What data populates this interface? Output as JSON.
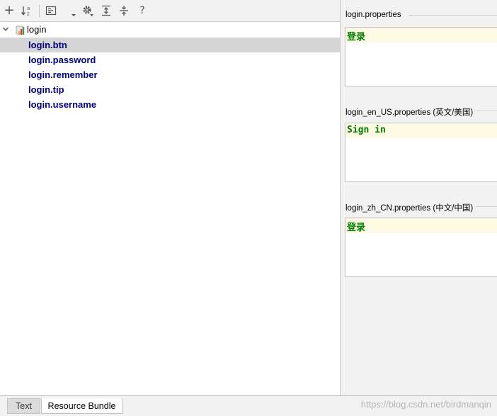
{
  "toolbar": {
    "buttons": [
      {
        "name": "add-property-button",
        "icon": "plus-icon",
        "glyph": "+"
      },
      {
        "name": "sort-alphabetically-button",
        "icon": "sort-az-icon"
      },
      {
        "name": "group-by-prefix-button",
        "icon": "group-icon"
      },
      {
        "name": "dropdown-button",
        "icon": "dropdown-arrow-icon"
      },
      {
        "name": "settings-button",
        "icon": "gear-icon"
      },
      {
        "name": "expand-all-button",
        "icon": "expand-all-icon"
      },
      {
        "name": "collapse-all-button",
        "icon": "collapse-all-icon"
      },
      {
        "name": "help-button",
        "icon": "help-icon",
        "glyph": "?"
      }
    ]
  },
  "tree": {
    "root": {
      "label": "login",
      "icon": "resource-bundle-icon",
      "expanded": true
    },
    "keys": [
      {
        "label": "login.btn",
        "selected": true
      },
      {
        "label": "login.password",
        "selected": false
      },
      {
        "label": "login.remember",
        "selected": false
      },
      {
        "label": "login.tip",
        "selected": false
      },
      {
        "label": "login.username",
        "selected": false
      }
    ]
  },
  "editors": [
    {
      "title": "login.properties",
      "value": "登录"
    },
    {
      "title": "login_en_US.properties (英文/美国)",
      "value": "Sign in"
    },
    {
      "title": "login_zh_CN.properties (中文/中国)",
      "value": "登录"
    }
  ],
  "tabs": [
    {
      "label": "Text",
      "active": false
    },
    {
      "label": "Resource Bundle",
      "active": true
    }
  ],
  "watermark": "https://blog.csdn.net/birdmanqin",
  "colors": {
    "key_text": "#000080",
    "value_text": "#008000",
    "selection": "#d5d5d5",
    "current_line": "#fffae3"
  }
}
